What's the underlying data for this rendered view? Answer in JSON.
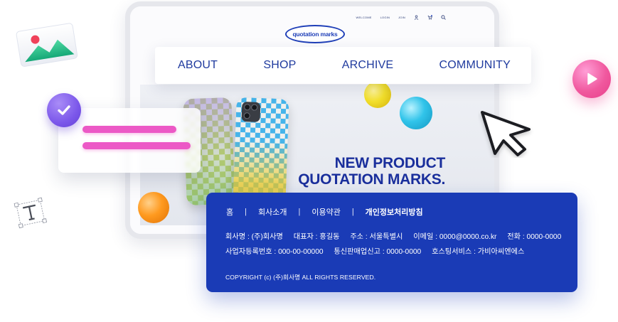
{
  "header": {
    "top_links": [
      "WELCOME",
      "LOGIN",
      "JOIN"
    ],
    "logo_text": "quotation marks"
  },
  "nav": {
    "items": [
      "ABOUT",
      "SHOP",
      "ARCHIVE",
      "COMMUNITY"
    ]
  },
  "hero": {
    "title_line1": "NEW PRODUCT",
    "title_line2": "QUOTATION MARKS."
  },
  "footer": {
    "links": [
      "홈",
      "회사소개",
      "이용약관",
      "개인정보처리방침"
    ],
    "separator": "|",
    "company": "회사명 : (주)회사명",
    "ceo": "대표자 : 홍길동",
    "address": "주소 : 서울특별시",
    "email": "이메일 : 0000@0000.co.kr",
    "phone": "전화 : 0000-0000",
    "business_no": "사업자등록번호 : 000-00-00000",
    "ecommerce_no": "통신판매업신고 : 0000-0000",
    "hosting": "호스팅서비스 : 가비아씨엔에스",
    "copyright": "COPYRIGHT (c) (주)회사명 ALL RIGHTS RESERVED."
  },
  "colors": {
    "brand_blue": "#1a3bb6",
    "nav_text": "#1f3a9e",
    "pink_accent": "#ec59c6",
    "purple_check": "#7b57ea",
    "play_pink": "#f0589e"
  },
  "icons": [
    "user-icon",
    "cart-icon",
    "search-icon",
    "checkmark-icon",
    "play-icon",
    "image-icon",
    "text-tool-icon",
    "cursor-arrow-icon"
  ]
}
